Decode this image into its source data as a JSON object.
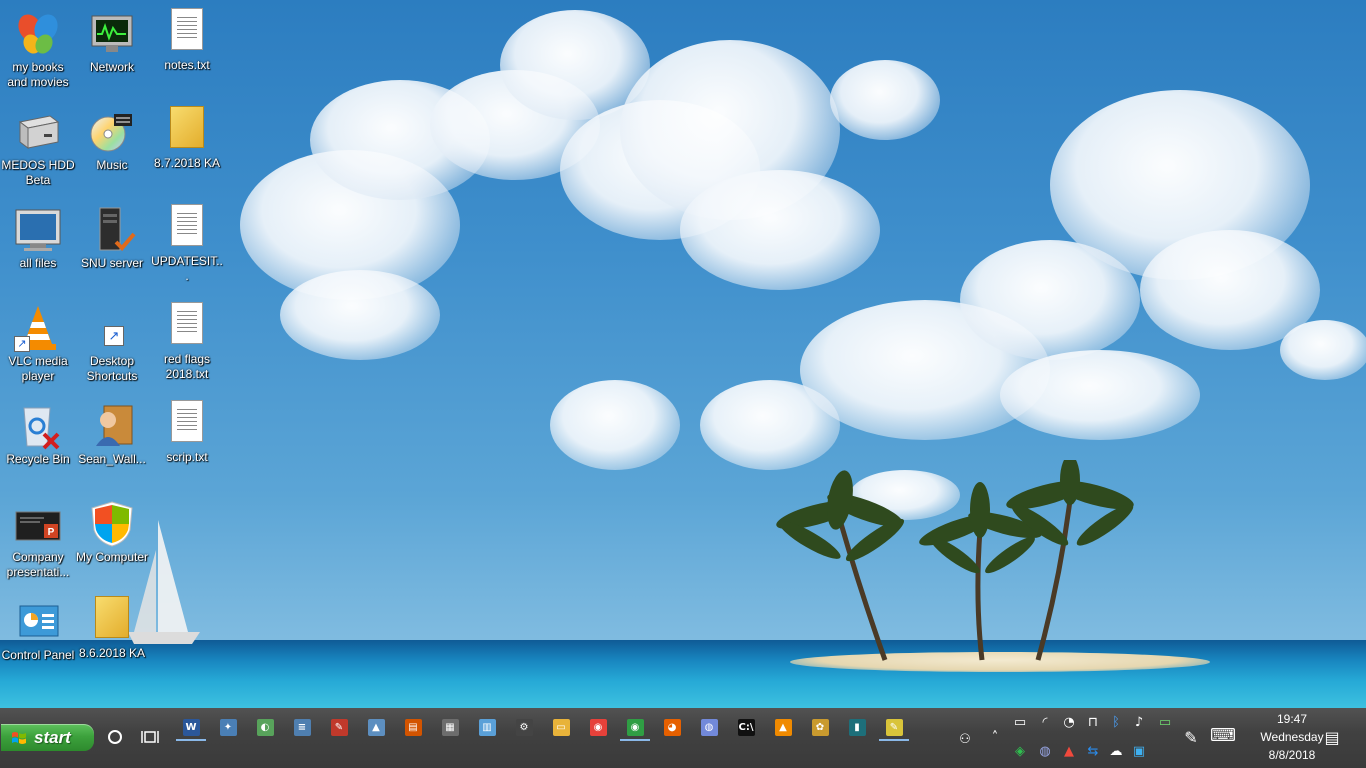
{
  "desktop": {
    "icons": [
      {
        "label": "my books and movies",
        "icon": "msn-butterfly-icon"
      },
      {
        "label": "Network",
        "icon": "network-monitor-icon"
      },
      {
        "label": "notes.txt",
        "icon": "text-file-icon"
      },
      {
        "label": "MEDOS HDD Beta",
        "icon": "hard-drive-icon"
      },
      {
        "label": "Music",
        "icon": "cd-music-icon"
      },
      {
        "label": "8.7.2018 KA",
        "icon": "folder-icon"
      },
      {
        "label": "all files",
        "icon": "computer-monitor-icon"
      },
      {
        "label": "SNU server",
        "icon": "server-icon"
      },
      {
        "label": "UPDATESIT...",
        "icon": "text-file-icon"
      },
      {
        "label": "VLC media player",
        "icon": "vlc-cone-icon"
      },
      {
        "label": "Desktop Shortcuts",
        "icon": "shortcut-icon"
      },
      {
        "label": "red flags 2018.txt",
        "icon": "text-file-icon"
      },
      {
        "label": "Recycle Bin",
        "icon": "recycle-bin-icon"
      },
      {
        "label": "Sean_Wall...",
        "icon": "user-folder-icon"
      },
      {
        "label": "scrip.txt",
        "icon": "text-file-icon"
      },
      {
        "label": "Company presentati...",
        "icon": "powerpoint-icon"
      },
      {
        "label": "My Computer",
        "icon": "windows-shield-icon"
      },
      {
        "label": "Control Panel",
        "icon": "control-panel-icon"
      },
      {
        "label": "8.6.2018 KA",
        "icon": "folder-icon"
      }
    ]
  },
  "taskbar": {
    "start_label": "start",
    "pinned": [
      {
        "name": "word",
        "glyph": "W",
        "color": "#2b579a",
        "active": true
      },
      {
        "name": "app-2",
        "glyph": "✦",
        "color": "#4a7fb5",
        "active": false
      },
      {
        "name": "paint",
        "glyph": "◐",
        "color": "#58a35b",
        "active": false
      },
      {
        "name": "notepad",
        "glyph": "≡",
        "color": "#4f7fb0",
        "active": false
      },
      {
        "name": "app-5",
        "glyph": "✎",
        "color": "#c0392b",
        "active": false
      },
      {
        "name": "photos",
        "glyph": "▲",
        "color": "#5d8fc0",
        "active": false
      },
      {
        "name": "film",
        "glyph": "▤",
        "color": "#d35400",
        "active": false
      },
      {
        "name": "calculator",
        "glyph": "▦",
        "color": "#6d6d6d",
        "active": false
      },
      {
        "name": "notes",
        "glyph": "▥",
        "color": "#5aa0d8",
        "active": false
      },
      {
        "name": "settings",
        "glyph": "⚙",
        "color": "#444",
        "active": false
      },
      {
        "name": "file-explorer",
        "glyph": "▭",
        "color": "#e8b33a",
        "active": false
      },
      {
        "name": "chrome",
        "glyph": "◉",
        "color": "#e6413a",
        "active": false
      },
      {
        "name": "chrome-2",
        "glyph": "◉",
        "color": "#2f9e44",
        "active": true
      },
      {
        "name": "firefox",
        "glyph": "◕",
        "color": "#e66000",
        "active": false
      },
      {
        "name": "discord",
        "glyph": "◍",
        "color": "#7289da",
        "active": false
      },
      {
        "name": "command-prompt",
        "glyph": "C:\\",
        "color": "#111",
        "active": false
      },
      {
        "name": "vlc",
        "glyph": "▲",
        "color": "#f08a00",
        "active": false
      },
      {
        "name": "app-18",
        "glyph": "✿",
        "color": "#c99a2e",
        "active": false
      },
      {
        "name": "app-19",
        "glyph": "▮",
        "color": "#1d6f7a",
        "active": false
      },
      {
        "name": "sticky-notes",
        "glyph": "✎",
        "color": "#d9c43a",
        "active": true
      }
    ],
    "tray_top": [
      {
        "name": "people-icon",
        "glyph": "⚇"
      },
      {
        "name": "show-hidden-icons",
        "glyph": "˄"
      },
      {
        "name": "tablet-icon",
        "glyph": "▭"
      },
      {
        "name": "wifi-icon",
        "glyph": "◜"
      },
      {
        "name": "security-icon",
        "glyph": "◔"
      },
      {
        "name": "lock-icon",
        "glyph": "⊓"
      },
      {
        "name": "bluetooth-icon",
        "glyph": "ᛒ"
      },
      {
        "name": "volume-icon",
        "glyph": "♪"
      },
      {
        "name": "battery-icon",
        "glyph": "▭"
      }
    ],
    "tray_bottom": [
      {
        "name": "shield-icon",
        "glyph": "◈"
      },
      {
        "name": "discord-tray-icon",
        "glyph": "◍"
      },
      {
        "name": "vlc-tray-icon",
        "glyph": "▲"
      },
      {
        "name": "teamviewer-icon",
        "glyph": "⇆"
      },
      {
        "name": "onedrive-icon",
        "glyph": "☁"
      },
      {
        "name": "monitor-tray-icon",
        "glyph": "▣"
      }
    ],
    "pen_icon": "✎",
    "keyboard_icon": "⌨",
    "clock": {
      "time": "19:47",
      "day": "Wednesday",
      "date": "8/8/2018"
    },
    "notification_icon": "▤"
  }
}
